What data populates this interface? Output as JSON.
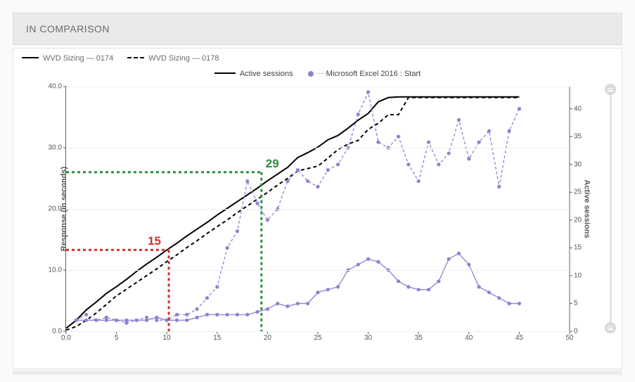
{
  "header": {
    "title": "IN COMPARISON"
  },
  "legend_runs": [
    {
      "swatch": "solid",
      "label": "WVD Sizing — 0174"
    },
    {
      "swatch": "dashed",
      "label": "WVD Sizing — 0178"
    }
  ],
  "legend_series": {
    "s1": "Active sessions",
    "s2": "Microsoft Excel 2016 : Start"
  },
  "axes": {
    "left_label": "Response (in seconds)",
    "right_label": "Active sessions",
    "x_ticks": [
      "0.0",
      "5",
      "10",
      "15",
      "20",
      "25",
      "30",
      "35",
      "40",
      "45",
      "50"
    ],
    "y_left_ticks": [
      "0.0",
      "10.0",
      "20.0",
      "30.0",
      "40.0"
    ],
    "y_right_ticks": [
      "0",
      "5",
      "10",
      "15",
      "20",
      "25",
      "30",
      "35",
      "40"
    ]
  },
  "annotations": {
    "red": {
      "value": "15",
      "x": 10.2,
      "y_left": 13.3
    },
    "green": {
      "value": "29",
      "x": 19.4,
      "y_left": 26.0
    }
  },
  "chart_data": {
    "type": "line",
    "title": "",
    "xlabel": "",
    "ylabel_left": "Response (in seconds)",
    "ylabel_right": "Active sessions",
    "xlim": [
      0,
      50
    ],
    "ylim_left": [
      0,
      40
    ],
    "ylim_right": [
      0,
      44
    ],
    "series": [
      {
        "name": "Active sessions — WVD Sizing 0174",
        "axis": "left",
        "style": "solid",
        "color": "#000000",
        "x": [
          0,
          1,
          2,
          3,
          4,
          5,
          6,
          7,
          8,
          9,
          10,
          11,
          12,
          13,
          14,
          15,
          16,
          17,
          18,
          19,
          20,
          21,
          22,
          23,
          24,
          25,
          26,
          27,
          28,
          29,
          30,
          31,
          32,
          33,
          34,
          35,
          36,
          37,
          38,
          39,
          40,
          41,
          42,
          43,
          44,
          45
        ],
        "y": [
          0.5,
          1.8,
          3.5,
          4.8,
          6.2,
          7.3,
          8.5,
          9.8,
          11.0,
          12.1,
          13.3,
          14.4,
          15.6,
          16.7,
          17.8,
          19.0,
          20.1,
          21.2,
          22.3,
          23.4,
          24.6,
          25.7,
          26.8,
          28.4,
          29.2,
          30.1,
          31.3,
          32.0,
          33.2,
          34.5,
          35.6,
          37.5,
          38.2,
          38.3,
          38.3,
          38.3,
          38.3,
          38.3,
          38.3,
          38.3,
          38.3,
          38.3,
          38.3,
          38.3,
          38.3,
          38.3
        ]
      },
      {
        "name": "Active sessions — WVD Sizing 0178",
        "axis": "left",
        "style": "dashed",
        "color": "#000000",
        "x": [
          0,
          1,
          2,
          3,
          4,
          5,
          6,
          7,
          8,
          9,
          10,
          11,
          12,
          13,
          14,
          15,
          16,
          17,
          18,
          19,
          20,
          21,
          22,
          23,
          24,
          25,
          26,
          27,
          28,
          29,
          30,
          31,
          32,
          33,
          34,
          35,
          36,
          37,
          38,
          39,
          40,
          41,
          42,
          43,
          44,
          45
        ],
        "y": [
          0.2,
          0.8,
          1.8,
          3.0,
          4.4,
          5.8,
          6.9,
          8.0,
          9.1,
          10.2,
          11.4,
          12.5,
          13.7,
          14.8,
          16.0,
          17.1,
          18.2,
          19.4,
          20.5,
          21.6,
          22.7,
          23.9,
          25.0,
          26.2,
          26.6,
          27.0,
          28.3,
          29.7,
          30.6,
          31.2,
          33,
          34,
          35.4,
          35.4,
          38.2,
          38.2,
          38.2,
          38.2,
          38.2,
          38.2,
          38.2,
          38.2,
          38.2,
          38.2,
          38.2,
          38.2
        ]
      },
      {
        "name": "Microsoft Excel 2016 : Start — WVD Sizing 0174",
        "axis": "right",
        "style": "solid-dots",
        "color": "#937fd1",
        "x": [
          1,
          2,
          3,
          4,
          5,
          6,
          7,
          8,
          9,
          10,
          11,
          12,
          13,
          14,
          15,
          16,
          17,
          18,
          19,
          20,
          21,
          22,
          23,
          24,
          25,
          26,
          27,
          28,
          29,
          30,
          31,
          32,
          33,
          34,
          35,
          36,
          37,
          38,
          39,
          40,
          41,
          42,
          43,
          44,
          45
        ],
        "y": [
          2,
          2,
          2,
          2,
          2,
          2,
          2,
          2,
          2.5,
          2,
          2,
          2,
          2.5,
          3,
          3,
          3,
          3,
          3,
          3.5,
          4,
          5,
          4.5,
          5,
          5,
          7,
          7.5,
          8,
          11,
          12,
          13,
          12.5,
          11,
          9,
          8,
          7.5,
          7.5,
          9,
          13,
          14,
          12,
          8,
          7,
          6,
          5,
          5
        ]
      },
      {
        "name": "Microsoft Excel 2016 : Start — WVD Sizing 0178",
        "axis": "right",
        "style": "dashed-dots",
        "color": "#937fd1",
        "x": [
          1,
          2,
          3,
          4,
          5,
          6,
          7,
          8,
          9,
          10,
          11,
          12,
          13,
          14,
          15,
          16,
          17,
          18,
          19,
          20,
          21,
          22,
          23,
          24,
          25,
          26,
          27,
          28,
          29,
          30,
          31,
          32,
          33,
          34,
          35,
          36,
          37,
          38,
          39,
          40,
          41,
          42,
          43,
          44,
          45
        ],
        "y": [
          2,
          3,
          2,
          2.5,
          2,
          1.5,
          2,
          2.5,
          2,
          2,
          3,
          3,
          4,
          6,
          8,
          15,
          18,
          27,
          23,
          20,
          22,
          27,
          29,
          27,
          26,
          29,
          30,
          33,
          39,
          43,
          34,
          33,
          35,
          30,
          27,
          34,
          30,
          32,
          38,
          31,
          34,
          36,
          26,
          36,
          40
        ]
      }
    ]
  }
}
